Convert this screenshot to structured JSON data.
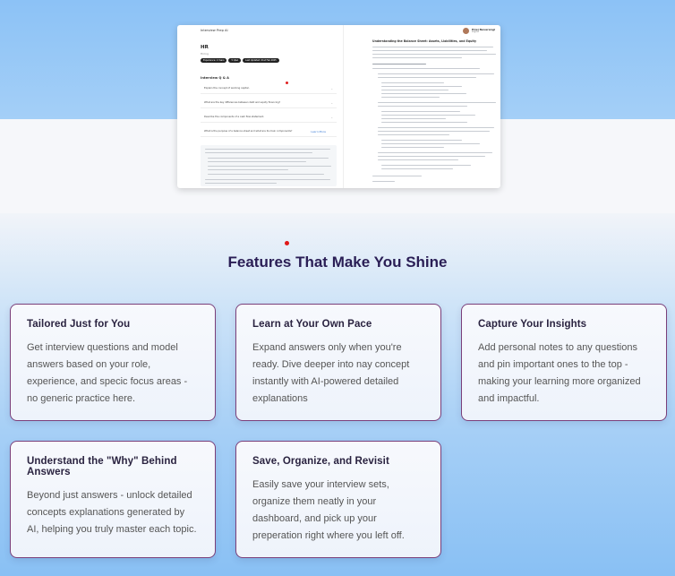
{
  "preview": {
    "window_title": "Interview Prep AI",
    "role": "HR",
    "role_sub": "Hiring",
    "tags": [
      "Experience: 2 Years",
      "5 Q&A",
      "Last Updated: 01st Feb 2025"
    ],
    "section_title": "Interview Q & A",
    "questions": [
      "Explain the concept of working capital.",
      "What are the key differences between debt and equity financing?",
      "Describe the components of a cash flow statement.",
      "What is the purpose of a balance sheet and what are its main components?"
    ],
    "learn_more_label": "Learn More",
    "user_name": "Priel Navarangi",
    "user_plan": "Logout",
    "right_title": "Understanding the Balance Sheet: Assets, Liabilities, and Equity"
  },
  "features": {
    "heading": "Features That Make You Shine",
    "cards": [
      {
        "title": "Tailored Just for You",
        "body": "Get interview questions and model answers based on your role, experience, and specic focus areas - no generic practice here."
      },
      {
        "title": "Learn at Your Own Pace",
        "body": "Expand answers only when you're ready. Dive deeper into nay concept instantly with AI-powered detailed explanations"
      },
      {
        "title": "Capture Your Insights",
        "body": "Add personal notes to any questions and pin important ones to the top - making your learning more organized and impactful."
      },
      {
        "title": "Understand the \"Why\" Behind Answers",
        "body": "Beyond just answers - unlock detailed concepts explanations generated by AI, helping you truly master each topic."
      },
      {
        "title": "Save, Organize, and Revisit",
        "body": "Easily save your interview sets, organize them neatly in your dashboard, and pick up your preperation right where you left off."
      }
    ]
  },
  "colors": {
    "accent_dark": "#2a1e55",
    "card_border": "#7a3f7a",
    "dot": "#e01818"
  }
}
